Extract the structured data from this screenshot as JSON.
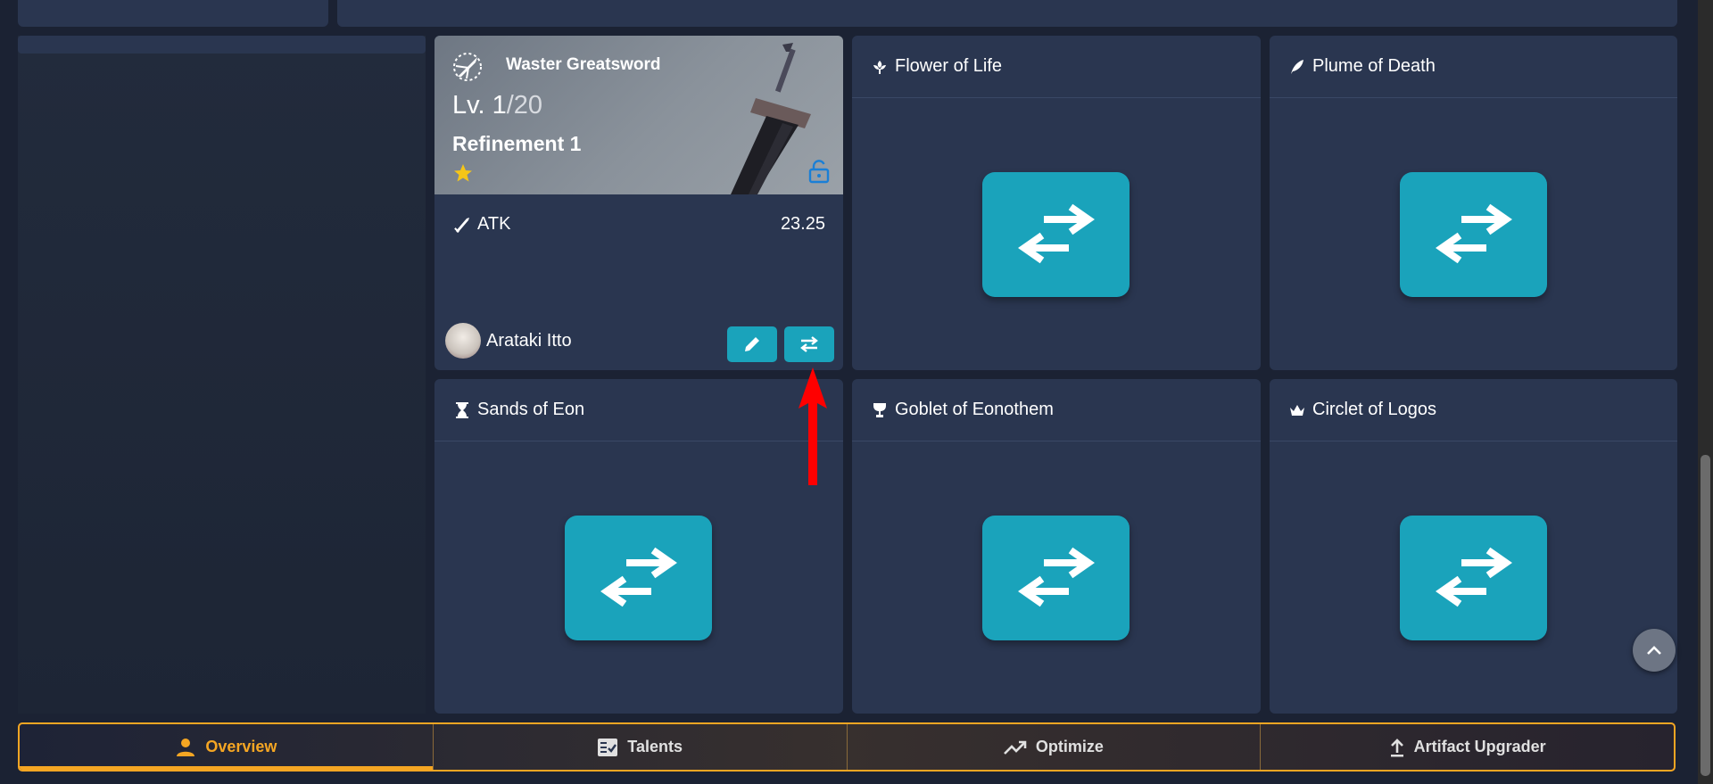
{
  "weapon": {
    "name": "Waster Greatsword",
    "level": "Lv. 1",
    "level_max": "/20",
    "refinement": "Refinement 1",
    "stat_label": "ATK",
    "stat_value": "23.25",
    "owner": "Arataki Itto",
    "rarity_stars": 1
  },
  "artifact_slots": [
    {
      "label": "Flower of Life",
      "icon": "flower-icon"
    },
    {
      "label": "Plume of Death",
      "icon": "plume-icon"
    },
    {
      "label": "Sands of Eon",
      "icon": "hourglass-icon"
    },
    {
      "label": "Goblet of Eonothem",
      "icon": "goblet-icon"
    },
    {
      "label": "Circlet of Logos",
      "icon": "circlet-icon"
    }
  ],
  "nav": {
    "tabs": [
      {
        "label": "Overview",
        "icon": "person-icon"
      },
      {
        "label": "Talents",
        "icon": "talents-icon"
      },
      {
        "label": "Optimize",
        "icon": "trending-up-icon"
      },
      {
        "label": "Artifact Upgrader",
        "icon": "upload-icon"
      }
    ],
    "active": "Overview"
  },
  "colors": {
    "card": "#2a3650",
    "accent": "#1aa3bb",
    "nav_active": "#f5a623",
    "annotation_arrow": "#ff0000"
  }
}
